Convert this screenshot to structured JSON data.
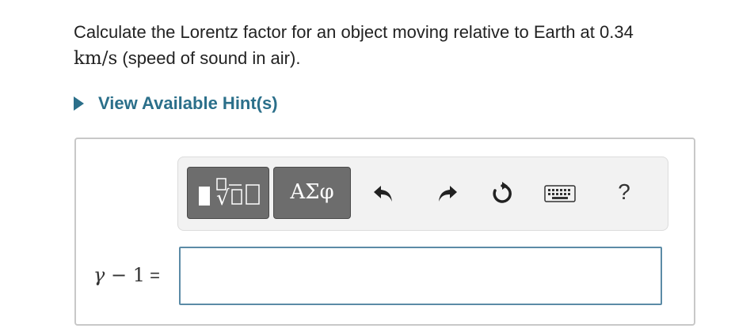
{
  "question": {
    "text_before": "Calculate the Lorentz factor for an object moving relative to Earth at 0.34",
    "unit": "km/s",
    "text_after": " (speed of sound in air)."
  },
  "hint": {
    "label": "View Available Hint(s)"
  },
  "toolbar": {
    "greek_label": "ΑΣφ",
    "help_label": "?",
    "icons": [
      "template-math-icon",
      "greek-symbols-icon",
      "undo-icon",
      "redo-icon",
      "reset-icon",
      "keyboard-icon",
      "help-icon"
    ]
  },
  "answer": {
    "gamma": "γ",
    "rest": " − 1",
    "equals": " =",
    "value": ""
  },
  "colors": {
    "link": "#2b6f8a",
    "input_border": "#5b8ba6",
    "button_bg": "#6d6d6d"
  }
}
